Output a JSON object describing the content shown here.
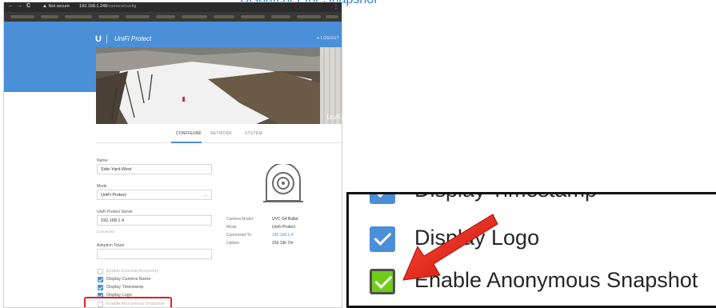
{
  "top_stray_text": "Dispatcher for Snapshot",
  "browser": {
    "nav_back": "←",
    "nav_forward": "→",
    "nav_reload": "C",
    "security_icon": "warning-icon",
    "security_label": "Not secure",
    "url_host": "192.168.1.248",
    "url_path": "/camera/config",
    "menu_icon": "⋮"
  },
  "header": {
    "logo": "U",
    "brand": "UniFi Protect",
    "logout": "⊲ LOGOUT",
    "watermark": "UniFi"
  },
  "tabs": [
    {
      "label": "CONFIGURE",
      "active": true
    },
    {
      "label": "NETWORK",
      "active": false
    },
    {
      "label": "SYSTEM",
      "active": false
    }
  ],
  "form": {
    "name_label": "Name",
    "name_value": "Side-Yard-West",
    "mode_label": "Mode",
    "mode_value": "UniFi Protect",
    "server_label": "UniFi Protect Server",
    "server_value": "192.168.1.4",
    "server_status": "Connected",
    "token_label": "Adoption Token",
    "token_value": ""
  },
  "info": {
    "rows": [
      {
        "key": "Camera Model:",
        "value": "UVC G4 Bullet"
      },
      {
        "key": "Mode:",
        "value": "UniFi Protect"
      },
      {
        "key": "Connected To:",
        "value": "192.168.1.4"
      },
      {
        "key": "Uptime:",
        "value": "22d 13h 7m"
      }
    ]
  },
  "checkboxes": [
    {
      "label": "Enable External Accessory",
      "checked": false
    },
    {
      "label": "Display Camera Name",
      "checked": true
    },
    {
      "label": "Display Timestamp",
      "checked": true
    },
    {
      "label": "Display Logo",
      "checked": true
    },
    {
      "label": "Enable Anonymous Snapshot",
      "checked": false
    }
  ],
  "zoom": {
    "row_timestamp": "Display Timestamp",
    "row_logo": "Display Logo",
    "row_snapshot": "Enable Anonymous Snapshot"
  },
  "colors": {
    "accent_blue": "#4a8fd8",
    "highlight_red": "#e01e1e",
    "checked_green": "#6fcd1a"
  }
}
